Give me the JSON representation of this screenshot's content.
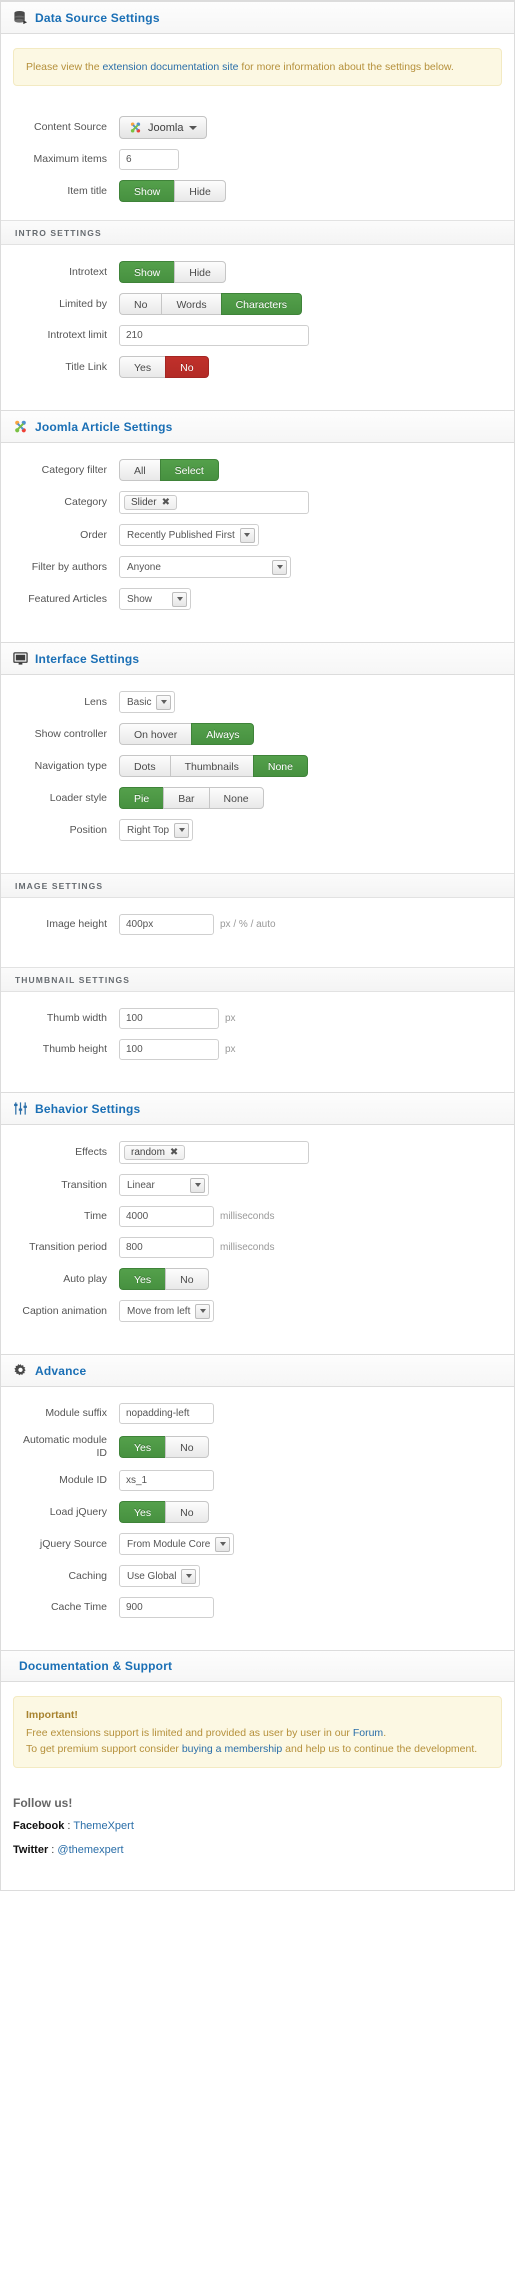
{
  "sections": {
    "data_source": {
      "title": "Data Source Settings",
      "icon": "database-icon",
      "notice": {
        "before": "Please view the ",
        "link": "extension documentation site",
        "after": " for more information about the settings below."
      },
      "rows": {
        "content_source": {
          "label": "Content Source",
          "value": "Joomla"
        },
        "maximum_items": {
          "label": "Maximum items",
          "value": "6"
        },
        "item_title": {
          "label": "Item title",
          "options": [
            "Show",
            "Hide"
          ],
          "selected": "Show"
        }
      }
    },
    "intro": {
      "title": "INTRO SETTINGS",
      "rows": {
        "introtext": {
          "label": "Introtext",
          "options": [
            "Show",
            "Hide"
          ],
          "selected": "Show"
        },
        "limited_by": {
          "label": "Limited by",
          "options": [
            "No",
            "Words",
            "Characters"
          ],
          "selected": "Characters"
        },
        "introtext_limit": {
          "label": "Introtext limit",
          "value": "210"
        },
        "title_link": {
          "label": "Title Link",
          "options": [
            "Yes",
            "No"
          ],
          "selected": "No"
        }
      }
    },
    "joomla_article": {
      "title": "Joomla Article Settings",
      "icon": "joomla-icon",
      "rows": {
        "category_filter": {
          "label": "Category filter",
          "options": [
            "All",
            "Select"
          ],
          "selected": "Select"
        },
        "category": {
          "label": "Category",
          "tags": [
            "Slider"
          ]
        },
        "order": {
          "label": "Order",
          "value": "Recently Published First"
        },
        "filter_by_authors": {
          "label": "Filter by authors",
          "value": "Anyone"
        },
        "featured_articles": {
          "label": "Featured Articles",
          "value": "Show"
        }
      }
    },
    "interface": {
      "title": "Interface Settings",
      "icon": "monitor-icon",
      "rows": {
        "lens": {
          "label": "Lens",
          "value": "Basic"
        },
        "show_controller": {
          "label": "Show controller",
          "options": [
            "On hover",
            "Always"
          ],
          "selected": "Always"
        },
        "navigation_type": {
          "label": "Navigation type",
          "options": [
            "Dots",
            "Thumbnails",
            "None"
          ],
          "selected": "None"
        },
        "loader_style": {
          "label": "Loader style",
          "options": [
            "Pie",
            "Bar",
            "None"
          ],
          "selected": "Pie"
        },
        "position": {
          "label": "Position",
          "value": "Right Top"
        }
      }
    },
    "image": {
      "title": "IMAGE SETTINGS",
      "rows": {
        "image_height": {
          "label": "Image height",
          "value": "400px",
          "suffix": "px / % / auto"
        }
      }
    },
    "thumbnail": {
      "title": "THUMBNAIL SETTINGS",
      "rows": {
        "thumb_width": {
          "label": "Thumb width",
          "value": "100",
          "suffix": "px"
        },
        "thumb_height": {
          "label": "Thumb height",
          "value": "100",
          "suffix": "px"
        }
      }
    },
    "behavior": {
      "title": "Behavior Settings",
      "icon": "sliders-icon",
      "rows": {
        "effects": {
          "label": "Effects",
          "tags": [
            "random"
          ]
        },
        "transition": {
          "label": "Transition",
          "value": "Linear"
        },
        "time": {
          "label": "Time",
          "value": "4000",
          "suffix": "milliseconds"
        },
        "transition_period": {
          "label": "Transition period",
          "value": "800",
          "suffix": "milliseconds"
        },
        "auto_play": {
          "label": "Auto play",
          "options": [
            "Yes",
            "No"
          ],
          "selected": "Yes"
        },
        "caption_animation": {
          "label": "Caption animation",
          "value": "Move from left"
        }
      }
    },
    "advance": {
      "title": "Advance",
      "icon": "gear-icon",
      "rows": {
        "module_suffix": {
          "label": "Module suffix",
          "value": "nopadding-left"
        },
        "automatic_module_id": {
          "label": "Automatic module ID",
          "options": [
            "Yes",
            "No"
          ],
          "selected": "Yes"
        },
        "module_id": {
          "label": "Module ID",
          "value": "xs_1"
        },
        "load_jquery": {
          "label": "Load jQuery",
          "options": [
            "Yes",
            "No"
          ],
          "selected": "Yes"
        },
        "jquery_source": {
          "label": "jQuery Source",
          "value": "From Module Core"
        },
        "caching": {
          "label": "Caching",
          "value": "Use Global"
        },
        "cache_time": {
          "label": "Cache Time",
          "value": "900"
        }
      }
    },
    "documentation": {
      "title": "Documentation & Support",
      "notice": {
        "important": "Important!",
        "line1_a": "Free extensions support is limited and provided as user by user in our ",
        "line1_link": "Forum",
        "line1_b": ".",
        "line2_a": "To get premium support consider ",
        "line2_link": "buying a membership",
        "line2_b": " and help us to continue the development."
      },
      "follow": {
        "heading": "Follow us!",
        "facebook_label": "Facebook",
        "facebook_sep": " : ",
        "facebook_value": "ThemeXpert",
        "twitter_label": "Twitter",
        "twitter_sep": " : ",
        "twitter_value": "@themexpert"
      }
    }
  },
  "colors": {
    "green": "#4a9a42",
    "red": "#bb2d26",
    "link": "#2a6ea8",
    "notice_bg": "#fcf8e3"
  }
}
